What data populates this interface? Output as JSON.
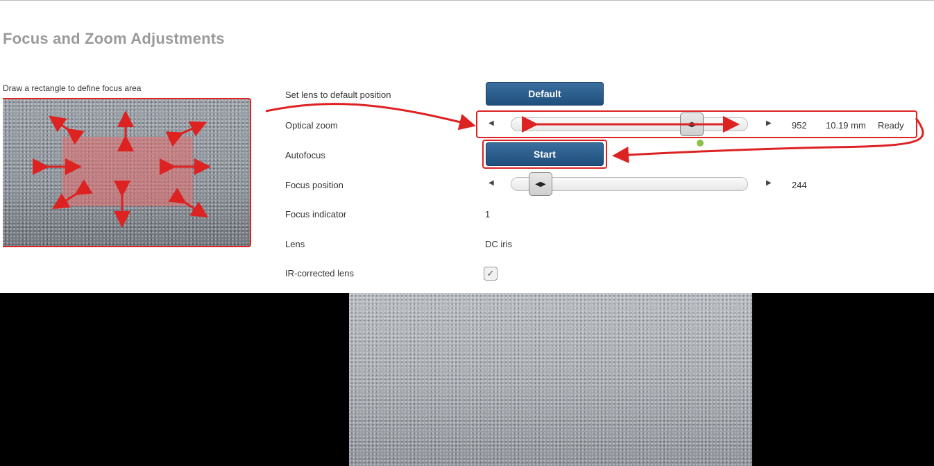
{
  "header": {
    "title": "Focus and Zoom Adjustments"
  },
  "focus_area": {
    "hint": "Draw a rectangle to define focus area"
  },
  "settings": {
    "default_lens": {
      "label": "Set lens to default position",
      "button": "Default"
    },
    "optical_zoom": {
      "label": "Optical zoom",
      "value": "952",
      "focal_length": "10.19 mm",
      "status": "Ready",
      "position": 0.79
    },
    "autofocus": {
      "label": "Autofocus",
      "button": "Start"
    },
    "focus_position": {
      "label": "Focus position",
      "value": "244",
      "position": 0.08
    },
    "focus_indicator": {
      "label": "Focus indicator",
      "value": "1"
    },
    "lens": {
      "label": "Lens",
      "value": "DC iris"
    },
    "ir_corrected": {
      "label": "IR-corrected lens",
      "checked": true
    }
  },
  "icons": {
    "left": "◀",
    "right": "▶",
    "thumb": "◀▶",
    "check": "✓"
  },
  "colors": {
    "accent": "#2a5d8c",
    "annotation": "#dd2222",
    "indicator": "#8bc34a"
  }
}
